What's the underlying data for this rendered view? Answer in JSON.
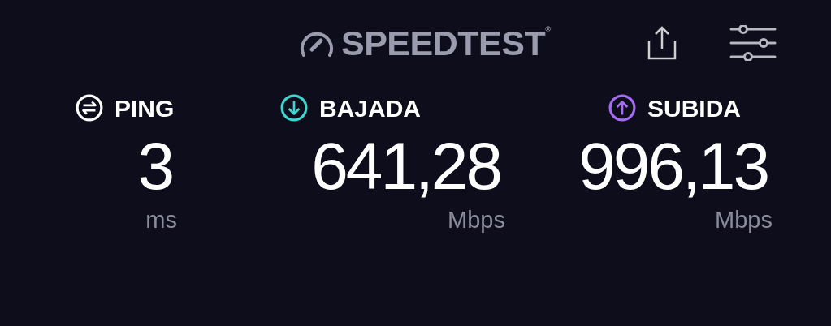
{
  "header": {
    "logo": "SPEEDTEST$^{®}$"
  },
  "metrics": [
    {
      "kind": "ping",
      "label": "PING",
      "value": "3",
      "unit": "ms",
      "color": "#ffffff"
    },
    {
      "kind": "download",
      "label": "BAJADA",
      "value": "641,28",
      "unit": "Mbps",
      "color": "#3fd6d0"
    },
    {
      "kind": "upload",
      "label": "SUBIDA",
      "value": "996,13",
      "unit": "Mbps",
      "color": "#a56cf0"
    }
  ]
}
